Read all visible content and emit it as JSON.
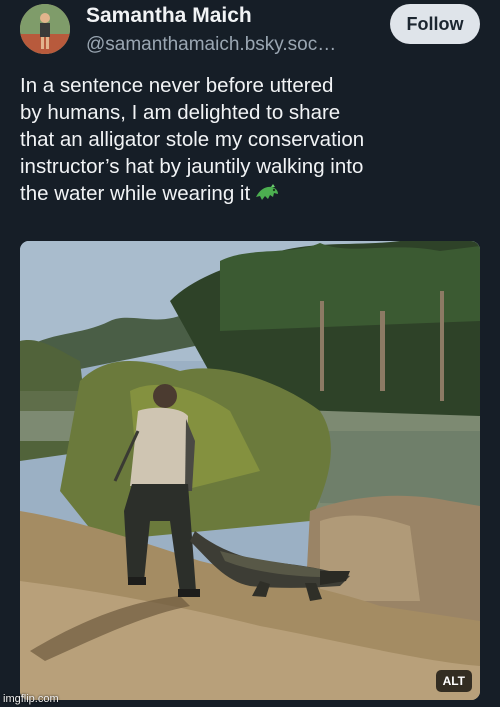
{
  "post": {
    "author_name": "Samantha Maich",
    "author_handle": "@samanthamaich.bsky.soc…",
    "follow_label": "Follow",
    "text_lines": [
      "In a sentence never before uttered",
      "by humans, I am delighted to share",
      "that an alligator stole my conservation",
      "instructor’s hat by jauntily walking into",
      "the water while wearing it"
    ],
    "emoji": "alligator-emoji",
    "image": {
      "alt_badge": "ALT",
      "description_icon": "photo"
    }
  },
  "watermark": "imgflip.com",
  "colors": {
    "background": "#161e27",
    "follow_button": "#dfe4ea",
    "handle_text": "#9aa6b2"
  }
}
